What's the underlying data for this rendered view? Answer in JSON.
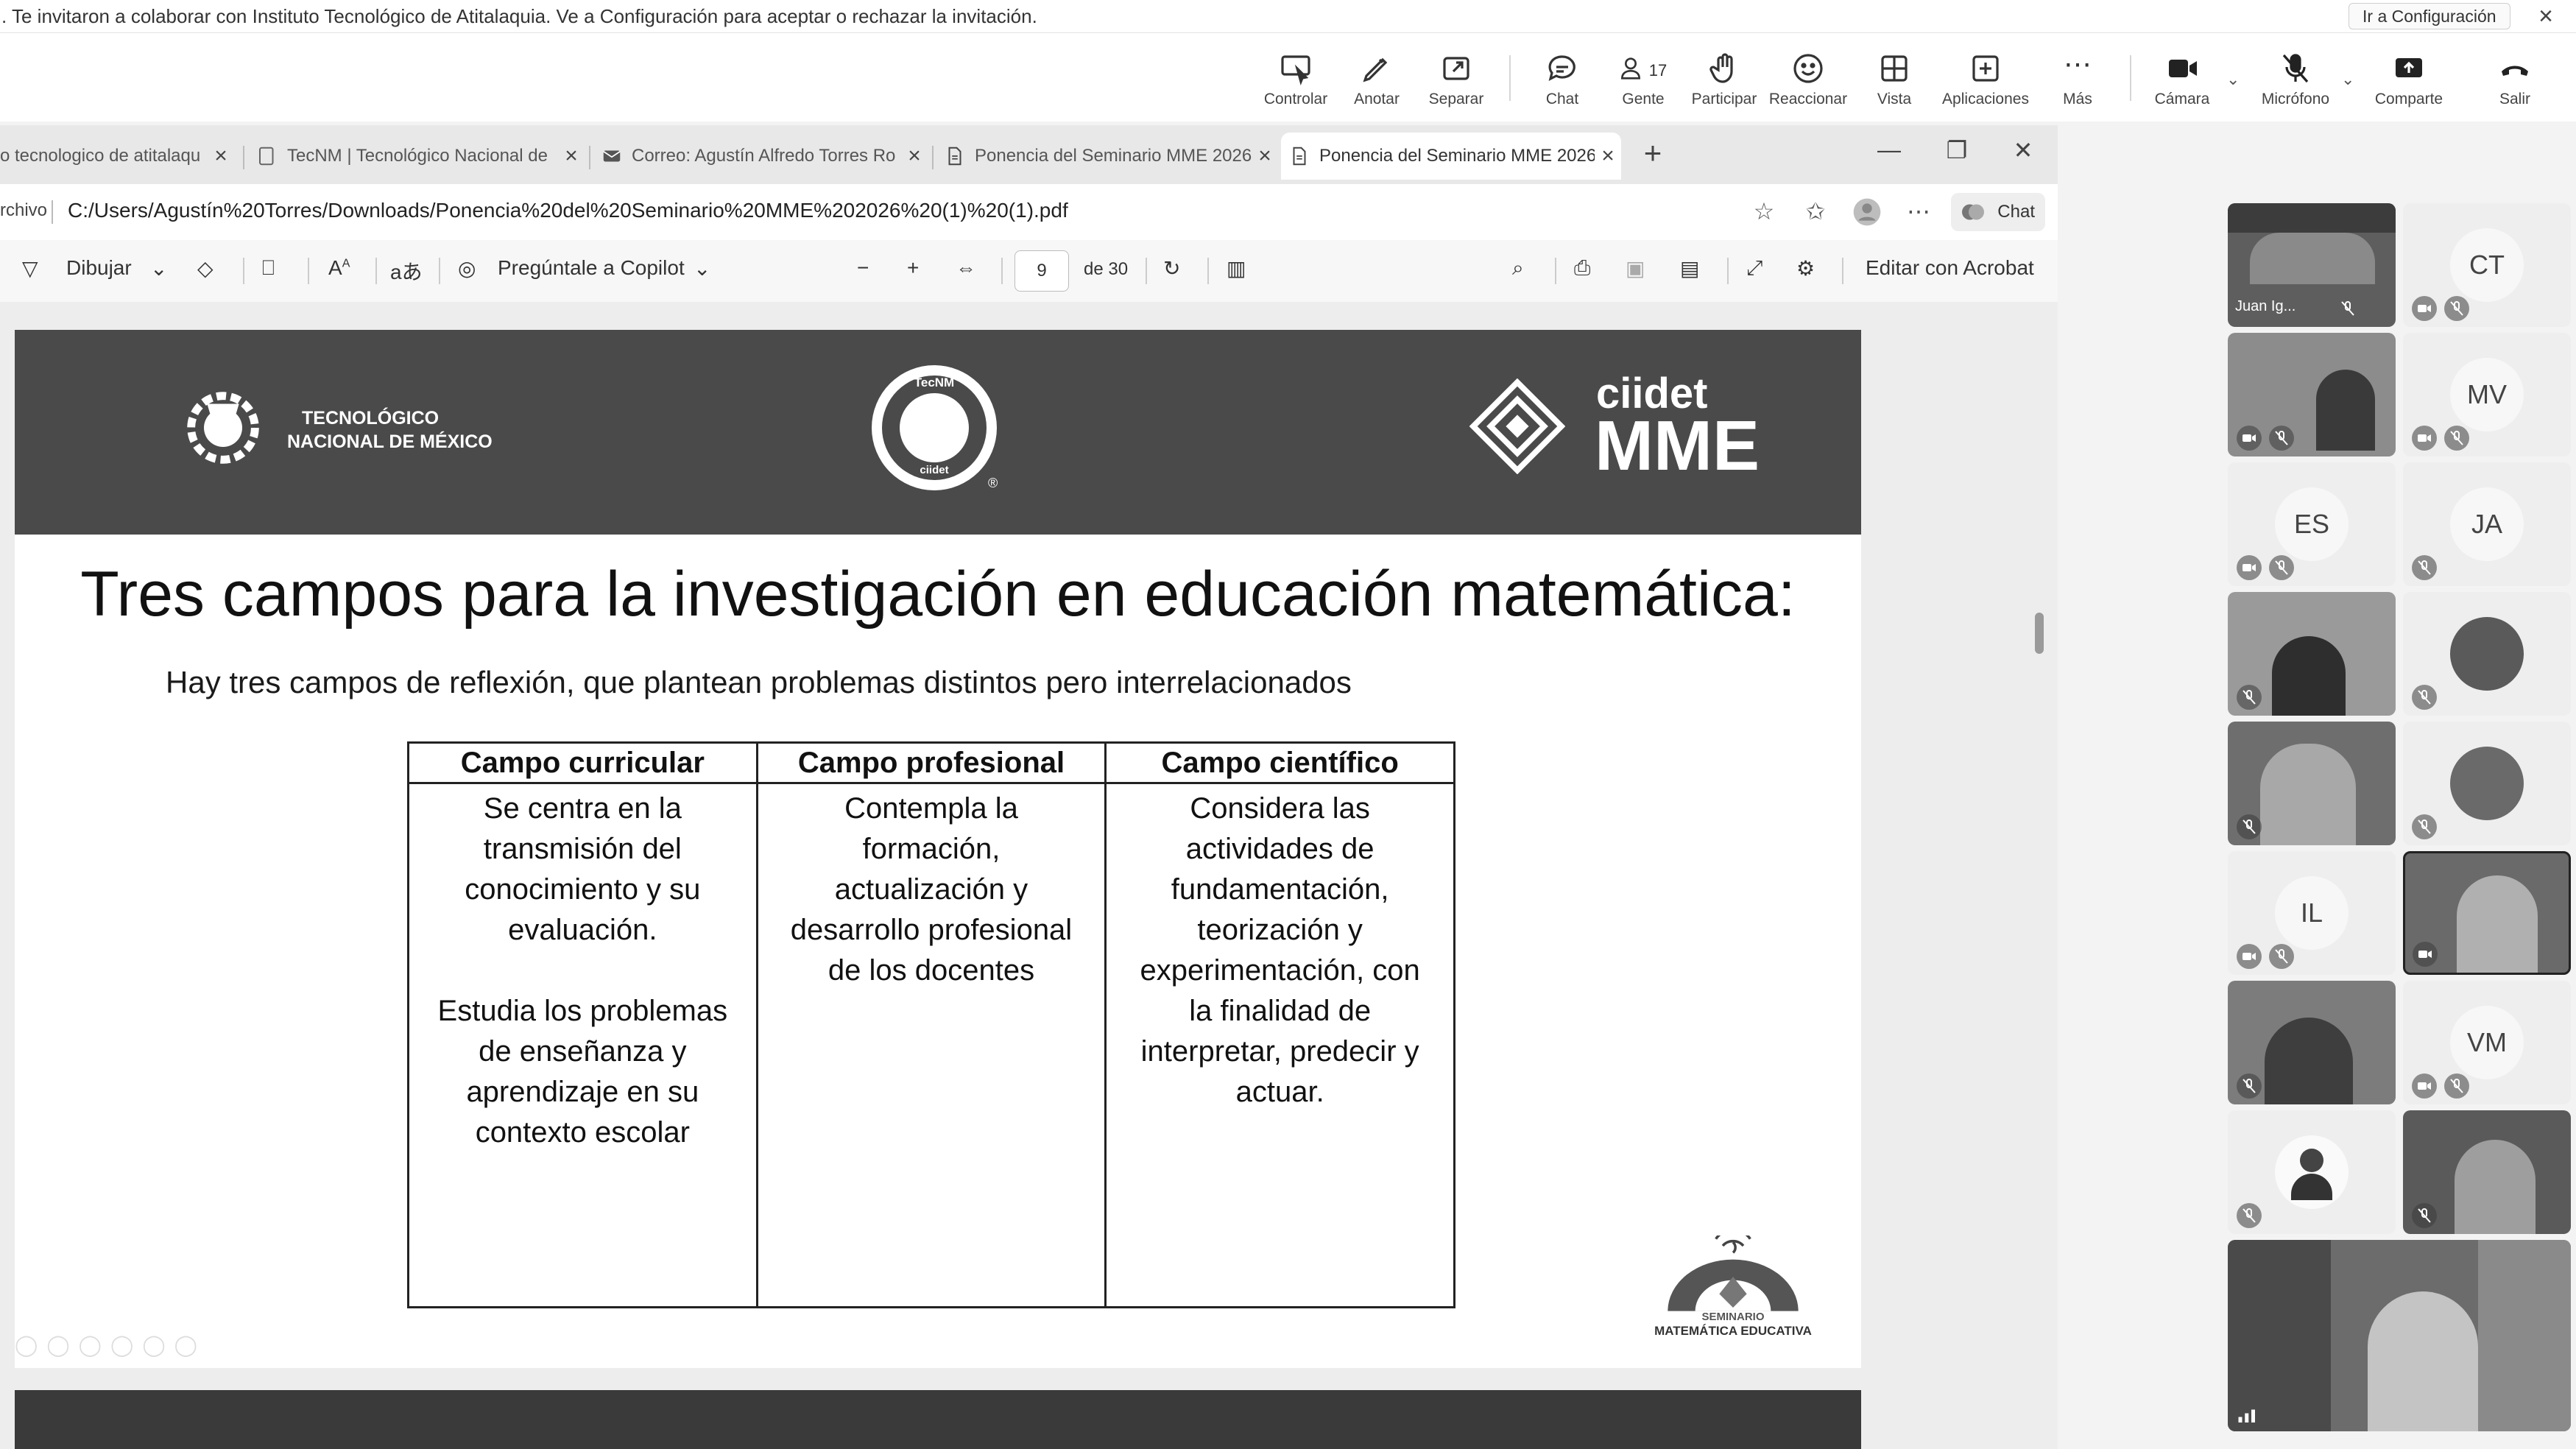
{
  "notification": {
    "text": ". Te invitaron a colaborar con Instituto Tecnológico de Atitalaquia. Ve a Configuración para aceptar o rechazar la invitación.",
    "action": "Ir a Configuración",
    "close": "×"
  },
  "meeting_toolbar": {
    "controlar": "Controlar",
    "anotar": "Anotar",
    "separar": "Separar",
    "chat": "Chat",
    "gente": "Gente",
    "gente_count": "17",
    "participar": "Participar",
    "reaccionar": "Reaccionar",
    "vista": "Vista",
    "aplicaciones": "Aplicaciones",
    "mas": "Más",
    "camara": "Cámara",
    "microfono": "Micrófono",
    "comparte": "Comparte",
    "salir": "Salir"
  },
  "browser": {
    "tabs": [
      {
        "title": "o tecnologico de atitalaqu"
      },
      {
        "title": "TecNM | Tecnológico Nacional de"
      },
      {
        "title": "Correo: Agustín Alfredo Torres Ro"
      },
      {
        "title": "Ponencia del Seminario MME 2026"
      },
      {
        "title": "Ponencia del Seminario MME 2026"
      }
    ],
    "address_label": "rchivo",
    "url": "C:/Users/Agustín%20Torres/Downloads/Ponencia%20del%20Seminario%20MME%202026%20(1)%20(1).pdf",
    "chat_label": "Chat"
  },
  "pdf_toolbar": {
    "draw": "Dibujar",
    "copilot": "Pregúntale a Copilot",
    "page_current": "9",
    "page_total": "de 30",
    "edit_acrobat": "Editar con Acrobat"
  },
  "slide": {
    "logo_left_line1": "TECNOLÓGICO",
    "logo_left_line2": "NACIONAL DE MÉXICO",
    "logo_center_top": "TecNM",
    "logo_center_bottom": "ciidet",
    "logo_right_line1": "ciidet",
    "logo_right_line2": "MME",
    "title": "Tres campos para la investigación en educación matemática:",
    "subtitle": "Hay tres campos de reflexión, que plantean problemas distintos pero interrelacionados",
    "table": {
      "headers": [
        "Campo curricular",
        "Campo profesional",
        "Campo científico"
      ],
      "col1_p1": [
        "Se centra en la",
        "transmisión del",
        "conocimiento y su",
        "evaluación."
      ],
      "col1_p2": [
        "Estudia los problemas",
        "de enseñanza y",
        "aprendizaje en su",
        "contexto escolar"
      ],
      "col2": [
        "Contempla la",
        "formación,",
        "actualización y",
        "desarrollo profesional",
        "de los docentes"
      ],
      "col3": [
        "Considera las",
        "actividades de",
        "fundamentación,",
        "teorización y",
        "experimentación, con",
        "la finalidad de",
        "interpretar, predecir y",
        "actuar."
      ]
    },
    "seminar_line1": "SEMINARIO",
    "seminar_line2": "MATEMÁTICA EDUCATIVA"
  },
  "participants": {
    "juan": "Juan Ig...",
    "ct": "CT",
    "mv": "MV",
    "es": "ES",
    "ja": "JA",
    "il": "IL",
    "vm": "VM"
  },
  "colors": {
    "slide_header": "#4a4a4a",
    "background": "#f3f3f3",
    "toolbar": "#ffffff"
  }
}
